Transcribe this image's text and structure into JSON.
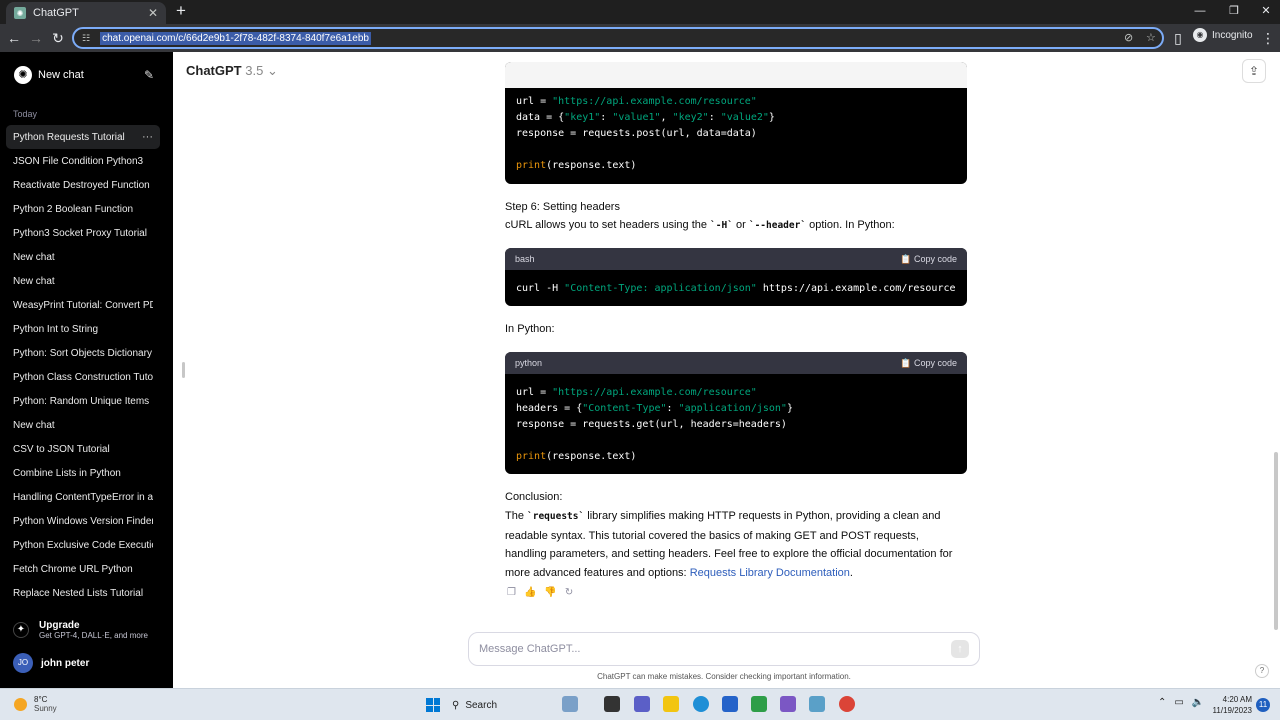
{
  "browser": {
    "tab_title": "ChatGPT",
    "url": "chat.openai.com/c/66d2e9b1-2f78-482f-8374-840f7e6a1ebb",
    "profile_label": "Incognito"
  },
  "sidebar": {
    "new_chat_label": "New chat",
    "section_label": "Today",
    "chats": [
      "Python Requests Tutorial",
      "JSON File Condition Python3",
      "Reactivate Destroyed Function",
      "Python 2 Boolean Function",
      "Python3 Socket Proxy Tutorial",
      "New chat",
      "New chat",
      "WeasyPrint Tutorial: Convert PDF",
      "Python Int to String",
      "Python: Sort Objects Dictionary",
      "Python Class Construction Tutorial",
      "Python: Random Unique Items",
      "New chat",
      "CSV to JSON Tutorial",
      "Combine Lists in Python",
      "Handling ContentTypeError in async",
      "Python Windows Version Finder",
      "Python Exclusive Code Execution",
      "Fetch Chrome URL Python",
      "Replace Nested Lists Tutorial"
    ],
    "upgrade_title": "Upgrade",
    "upgrade_subtitle": "Get GPT-4, DALL·E, and more",
    "user_initials": "JO",
    "user_name": "john peter"
  },
  "header": {
    "model_name": "ChatGPT",
    "model_version": "3.5"
  },
  "content": {
    "code1": {
      "l1a": "url = ",
      "l1b": "\"https://api.example.com/resource\"",
      "l2a": "data = {",
      "l2b": "\"key1\"",
      "l2c": ": ",
      "l2d": "\"value1\"",
      "l2e": ", ",
      "l2f": "\"key2\"",
      "l2g": ": ",
      "l2h": "\"value2\"",
      "l2i": "}",
      "l3": "response = requests.post(url, data=data)",
      "l5a": "print",
      "l5b": "(response.text)"
    },
    "step6_title": "Step 6: Setting headers",
    "step6_a": "cURL allows you to set headers using the ",
    "step6_code1": "`-H`",
    "step6_b": " or ",
    "step6_code2": "`--header`",
    "step6_c": " option. In Python:",
    "code2": {
      "lang": "bash",
      "copy": "Copy code",
      "l1a": "curl -H ",
      "l1b": "\"Content-Type: application/json\"",
      "l1c": " https://api.example.com/resource"
    },
    "in_python": "In Python:",
    "code3": {
      "lang": "python",
      "copy": "Copy code",
      "l1a": "url = ",
      "l1b": "\"https://api.example.com/resource\"",
      "l2a": "headers = {",
      "l2b": "\"Content-Type\"",
      "l2c": ": ",
      "l2d": "\"application/json\"",
      "l2e": "}",
      "l3": "response = requests.get(url, headers=headers)",
      "l5a": "print",
      "l5b": "(response.text)"
    },
    "conclusion_title": "Conclusion:",
    "conclusion_a": "The ",
    "conclusion_code": "`requests`",
    "conclusion_b": " library simplifies making HTTP requests in Python, providing a clean and readable syntax. This tutorial covered the basics of making GET and POST requests, handling parameters, and setting headers. Feel free to explore the official documentation for more advanced features and options: ",
    "conclusion_link": "Requests Library Documentation",
    "conclusion_end": "."
  },
  "composer": {
    "placeholder": "Message ChatGPT...",
    "disclaimer": "ChatGPT can make mistakes. Consider checking important information."
  },
  "taskbar": {
    "temperature": "8°C",
    "condition": "Sunny",
    "search_label": "Search",
    "time": "4:20 AM",
    "date": "11/19/2023",
    "notification_count": "11"
  },
  "colors": {
    "string": "#00a67d",
    "function": "#e9950c",
    "link": "#2d5dbb",
    "accent_omnibox": "#7cacf8"
  }
}
